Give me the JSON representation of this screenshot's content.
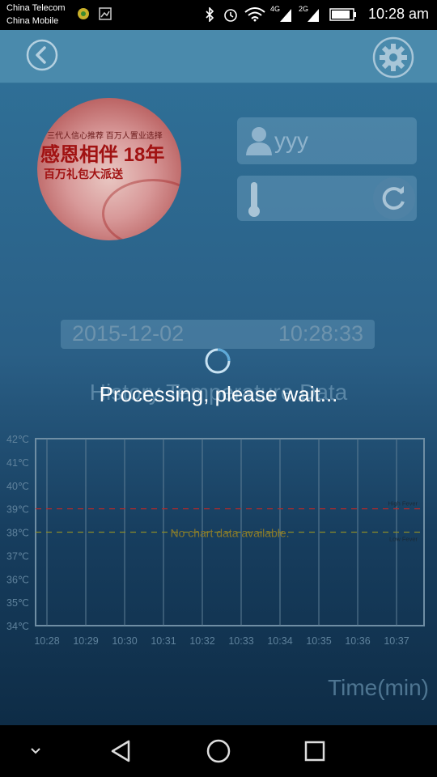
{
  "status_bar": {
    "carrier1": "China Telecom",
    "carrier2": "China Mobile",
    "net1": "4G",
    "net2": "2G",
    "clock": "10:28 am"
  },
  "profile": {
    "name": "yyy",
    "avatar_lines": [
      "三代人信心推荐  百万人置业选择",
      "感恩相伴 18年",
      "百万礼包大派送"
    ]
  },
  "reading": {
    "date": "2015-12-02",
    "time": "10:28:33"
  },
  "history_title": "History Temperature Data",
  "chart_data": {
    "type": "line",
    "x": [
      "10:28",
      "10:29",
      "10:30",
      "10:31",
      "10:32",
      "10:33",
      "10:34",
      "10:35",
      "10:36",
      "10:37"
    ],
    "y_ticks": [
      "42℃",
      "41℃",
      "40℃",
      "39℃",
      "38℃",
      "37℃",
      "36℃",
      "35℃",
      "34℃"
    ],
    "ylim": [
      34,
      42
    ],
    "series": [],
    "thresholds": [
      {
        "name": "High Fever",
        "value": 39,
        "color": "#b02a2a"
      },
      {
        "name": "Low Fever",
        "value": 38,
        "color": "#8a8a2a"
      }
    ],
    "empty_message": "No chart data available.",
    "xlabel": "Time(min)",
    "grid": true
  },
  "loading": {
    "message": "Processing, please wait..."
  },
  "colors": {
    "accent": "#4a8aac",
    "panel": "#6ea0be"
  },
  "icons": {
    "back": "back-icon",
    "settings": "gear-icon",
    "user": "user-icon",
    "thermometer": "thermometer-icon",
    "refresh": "refresh-icon",
    "nav_down": "chevron-down-icon",
    "nav_back": "nav-back-icon",
    "nav_home": "nav-home-icon",
    "nav_recents": "nav-recents-icon"
  }
}
